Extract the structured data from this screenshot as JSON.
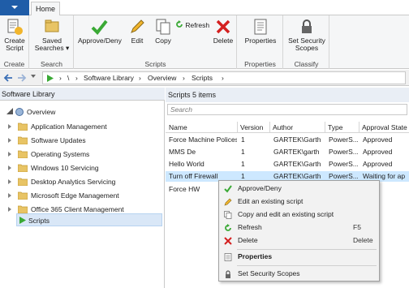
{
  "ribbon_tabs": {
    "home": "Home"
  },
  "ribbon": {
    "create": {
      "button": "Create Script",
      "group": "Create"
    },
    "search": {
      "button": "Saved Searches ▾",
      "group": "Search"
    },
    "scripts": {
      "approve": "Approve/Deny",
      "edit": "Edit",
      "copy": "Copy",
      "refresh": "Refresh",
      "delete": "Delete",
      "group": "Scripts"
    },
    "properties": {
      "button": "Properties",
      "group": "Properties"
    },
    "classify": {
      "button": "Set Security Scopes",
      "group": "Classify"
    }
  },
  "address": {
    "root": "\\",
    "crumbs": [
      "Software Library",
      "Overview",
      "Scripts"
    ],
    "separator": "›"
  },
  "left_pane": {
    "title": "Software Library",
    "overview": "Overview",
    "items": [
      "Application Management",
      "Software Updates",
      "Operating Systems",
      "Windows 10 Servicing",
      "Desktop Analytics Servicing",
      "Microsoft Edge Management",
      "Office 365 Client Management",
      "Scripts"
    ]
  },
  "right_pane": {
    "title": "Scripts 5 items",
    "search_placeholder": "Search",
    "columns": [
      "Name",
      "Version",
      "Author",
      "Type",
      "Approval State"
    ],
    "rows": [
      {
        "name": "Force Machine Polices",
        "version": "1",
        "author": "GARTEK\\Garth",
        "type": "PowerS...",
        "approval": "Approved"
      },
      {
        "name": "MMS De",
        "version": "1",
        "author": "GARTEK\\garth",
        "type": "PowerS...",
        "approval": "Approved"
      },
      {
        "name": "Hello World",
        "version": "1",
        "author": "GARTEK\\Garth",
        "type": "PowerS...",
        "approval": "Approved"
      },
      {
        "name": "Turn off Firewall",
        "version": "1",
        "author": "GARTEK\\Garth",
        "type": "PowerS...",
        "approval": "Waiting for ap"
      },
      {
        "name": "Force HW",
        "version": "",
        "author": "",
        "type": "",
        "approval": ""
      }
    ]
  },
  "context_menu": {
    "items": [
      {
        "label": "Approve/Deny",
        "shortcut": ""
      },
      {
        "label": "Edit an existing script",
        "shortcut": ""
      },
      {
        "label": "Copy and edit an existing script",
        "shortcut": ""
      },
      {
        "label": "Refresh",
        "shortcut": "F5"
      },
      {
        "label": "Delete",
        "shortcut": "Delete"
      },
      {
        "label": "Properties",
        "shortcut": ""
      },
      {
        "label": "Set Security Scopes",
        "shortcut": ""
      }
    ]
  },
  "colors": {
    "file_tab": "#1f5da8",
    "approve_green": "#3aa935",
    "delete_red": "#d42020",
    "folder_yellow": "#e8c465",
    "selection": "#cde8ff"
  }
}
